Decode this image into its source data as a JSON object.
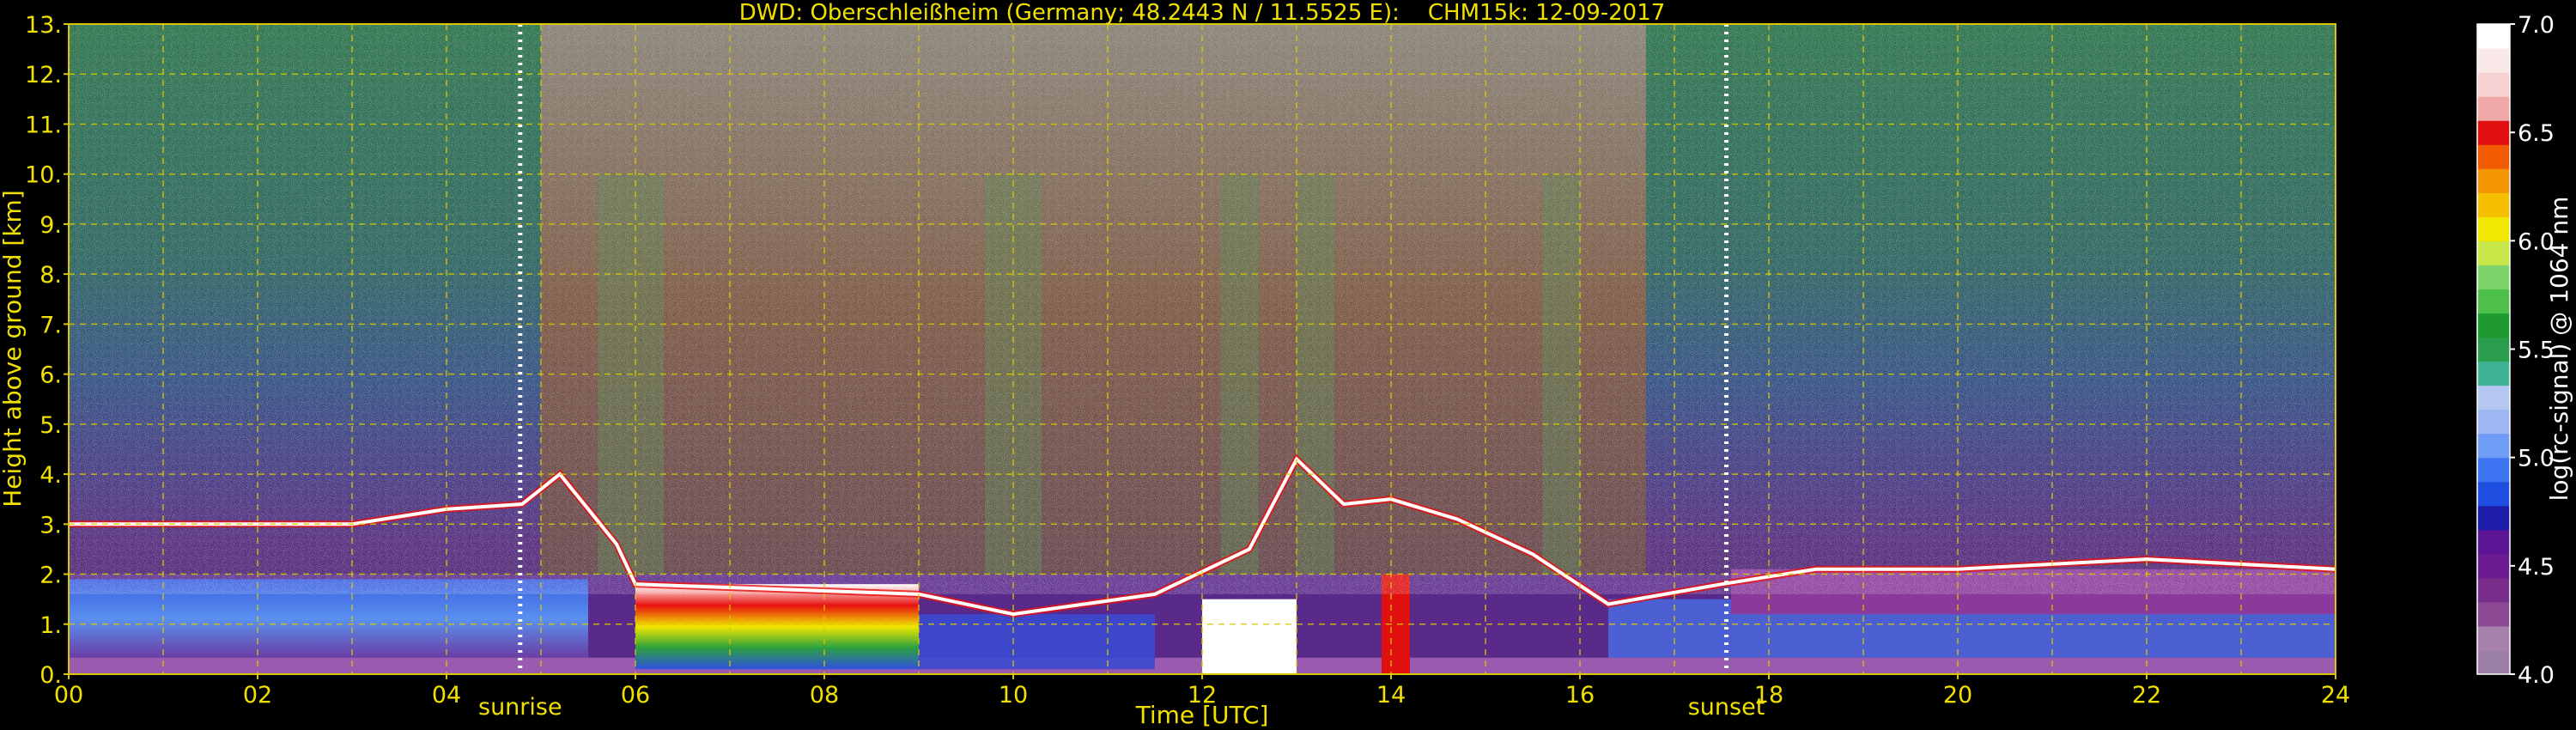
{
  "chart_data": {
    "type": "heatmap",
    "title": "DWD: Oberschleißheim (Germany; 48.2443 N / 11.5525 E):    CHM15k: 12-09-2017",
    "xlabel": "Time [UTC]",
    "ylabel": "Height above ground [km]",
    "xlim": [
      0,
      24
    ],
    "ylim": [
      0,
      13
    ],
    "x_ticks": [
      "00",
      "02",
      "04",
      "06",
      "08",
      "10",
      "12",
      "14",
      "16",
      "18",
      "20",
      "22",
      "24"
    ],
    "y_ticks": [
      "0.",
      "1.",
      "2.",
      "3.",
      "4.",
      "5.",
      "6.",
      "7.",
      "8.",
      "9.",
      "10.",
      "11.",
      "12.",
      "13."
    ],
    "grid": true,
    "colorbar": {
      "label": "log(rc-signal) @ 1064 nm",
      "range": [
        4.0,
        7.0
      ],
      "ticks": [
        "4.0",
        "4.5",
        "5.0",
        "5.5",
        "6.0",
        "6.5",
        "7.0"
      ],
      "colors": [
        "#9c7fa4",
        "#a681ab",
        "#8b4a93",
        "#7a2e8c",
        "#6a1b8f",
        "#5a1494",
        "#1d1ba8",
        "#1f4fe0",
        "#3c74f2",
        "#6f9cf5",
        "#9eb7f3",
        "#b6c6f2",
        "#3fb395",
        "#2a9d4c",
        "#1f9a30",
        "#4cc04a",
        "#7ed36a",
        "#c8e84a",
        "#f0e800",
        "#f5c000",
        "#f59600",
        "#f05a00",
        "#e01010",
        "#f0a8a8",
        "#f7d2d2",
        "#fbe8e8",
        "#ffffff"
      ]
    },
    "annotations": [
      {
        "text": "sunrise",
        "x": 4.78
      },
      {
        "text": "sunset",
        "x": 17.55
      }
    ],
    "features": {
      "upper_layer_km": [
        {
          "t": 0.0,
          "h": 3.0
        },
        {
          "t": 2.0,
          "h": 3.0
        },
        {
          "t": 3.0,
          "h": 3.0
        },
        {
          "t": 4.0,
          "h": 3.3
        },
        {
          "t": 4.8,
          "h": 3.4
        },
        {
          "t": 5.2,
          "h": 4.0
        },
        {
          "t": 5.8,
          "h": 2.6
        },
        {
          "t": 6.0,
          "h": 1.8
        },
        {
          "t": 9.0,
          "h": 1.6
        },
        {
          "t": 10.0,
          "h": 1.2
        },
        {
          "t": 11.5,
          "h": 1.6
        },
        {
          "t": 12.5,
          "h": 2.5
        },
        {
          "t": 13.0,
          "h": 4.3
        },
        {
          "t": 13.5,
          "h": 3.4
        },
        {
          "t": 14.0,
          "h": 3.5
        },
        {
          "t": 14.7,
          "h": 3.1
        },
        {
          "t": 15.5,
          "h": 2.4
        },
        {
          "t": 16.3,
          "h": 1.4
        },
        {
          "t": 17.5,
          "h": 1.8
        },
        {
          "t": 18.5,
          "h": 2.1
        },
        {
          "t": 20.0,
          "h": 2.1
        },
        {
          "t": 22.0,
          "h": 2.3
        },
        {
          "t": 24.0,
          "h": 2.1
        }
      ]
    }
  }
}
